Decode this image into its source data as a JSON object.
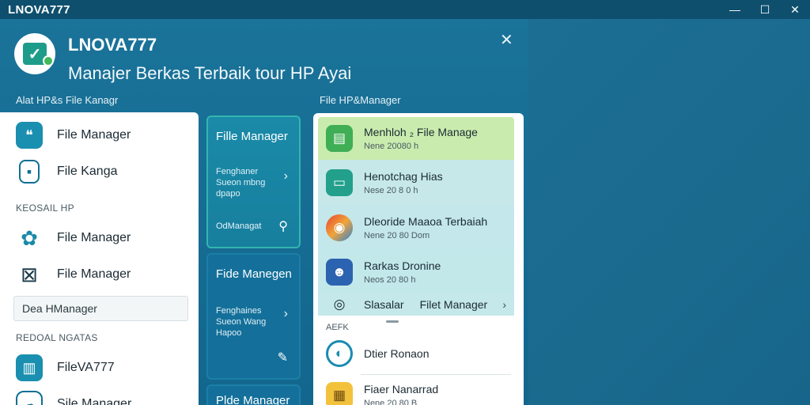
{
  "window": {
    "title": "LNOVA777",
    "controls": {
      "minimize": "—",
      "maximize": "☐",
      "close": "✕"
    }
  },
  "header": {
    "app_name": "LNOVA777",
    "subtitle": "Manajer Berkas Terbaik tour HP Ayai",
    "logo_icon": "check-icon",
    "close_label": "✕"
  },
  "sections": {
    "left_label": "Alat HP&s File Kanagr",
    "right_label": "File HP&Manager"
  },
  "left_list": {
    "items_top": [
      {
        "label": "File Manager",
        "icon": "chat-icon"
      },
      {
        "label": "File Kanga",
        "icon": "tablet-icon"
      }
    ],
    "subheading_1": "KEOSAIL HP",
    "items_mid": [
      {
        "label": "File Manager",
        "icon": "gear-icon"
      },
      {
        "label": "File Manager",
        "icon": "box-icon"
      }
    ],
    "search": {
      "value": "Dea HManager",
      "placeholder": ""
    },
    "subheading_2": "REDOAL NGATAS",
    "items_bottom": [
      {
        "label": "FileVA777",
        "icon": "book-icon"
      },
      {
        "label": "Sile Manager",
        "icon": "cloud-icon"
      }
    ]
  },
  "cards": [
    {
      "title": "Fille Manager",
      "desc": "Fenghaner Sueon mbng dpapo",
      "chevron": "›",
      "footer": "OdManagat",
      "footer_icon": "search-icon"
    },
    {
      "title": "Fide Manegen",
      "desc": "Fenghaines Sueon Wang Hapoo",
      "chevron": "›",
      "footer_icon": "pen-icon"
    },
    {
      "title": "Plde Manager"
    }
  ],
  "right_list": {
    "rows": [
      {
        "title": "Menhloh ₂ File Manage",
        "sub": "Nene 20080 h",
        "icon": "document-icon",
        "color": "#3fae55"
      },
      {
        "title": "Henotchag Hias",
        "sub": "Nese 20 8 0 h",
        "icon": "folder-icon",
        "color": "#22a08c"
      },
      {
        "title": "Dleoride Maaoa Terbaiah",
        "sub": "Nene 20 80 Dom",
        "icon": "app-icon",
        "color": "#e8432f"
      },
      {
        "title": "Rarkas Dronine",
        "sub": "Neos 20 80 h",
        "icon": "robot-icon",
        "color": "#2c63b0"
      }
    ],
    "partial_row": {
      "title": "Slasalar",
      "extra": "Filet Manager",
      "chevron": "›",
      "icon": "lightbulb-icon"
    },
    "subheading": "AEFK",
    "bottom_rows": [
      {
        "title": "Dtier Ronaon",
        "icon": "circle-icon"
      },
      {
        "title": "Fiaer Nanarrad",
        "sub": "Nene 20 80 B",
        "icon": "archive-icon"
      }
    ]
  },
  "colors": {
    "background": "#1d6f93",
    "titlebar": "#0f4f6e",
    "accent_teal": "#1b8fb0",
    "row_green": "#c9ecae",
    "row_cyan": "#c6e8e9"
  }
}
